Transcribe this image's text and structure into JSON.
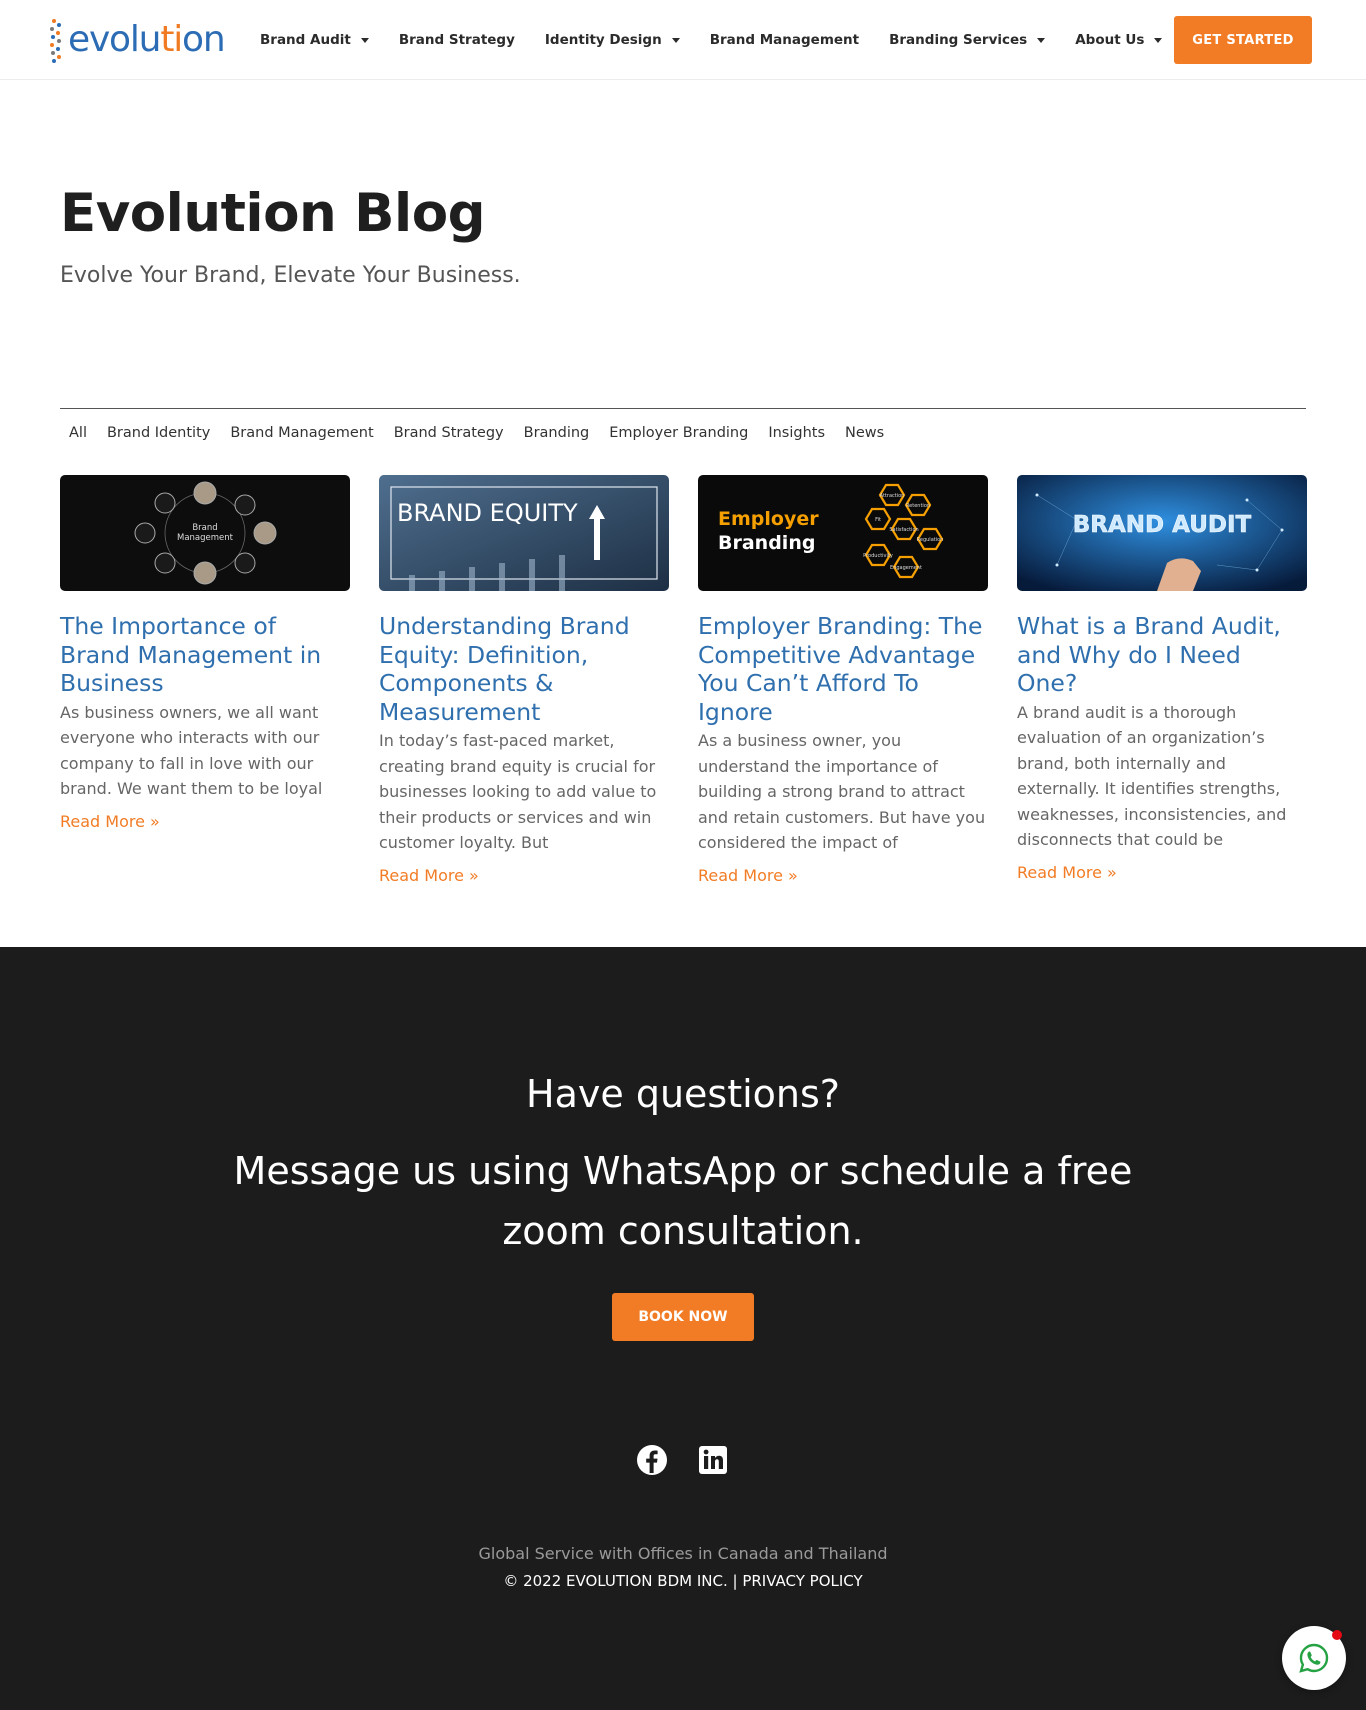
{
  "header": {
    "logo": {
      "part1": "evolu",
      "part2": "ti",
      "part3": "on"
    },
    "nav": [
      {
        "label": "Brand Audit",
        "dropdown": true
      },
      {
        "label": "Brand Strategy",
        "dropdown": false
      },
      {
        "label": "Identity Design",
        "dropdown": true
      },
      {
        "label": "Brand Management",
        "dropdown": false
      },
      {
        "label": "Branding Services",
        "dropdown": true
      },
      {
        "label": "About Us",
        "dropdown": true
      }
    ],
    "cta_label": "GET STARTED"
  },
  "hero": {
    "title": "Evolution Blog",
    "subtitle": "Evolve Your Brand, Elevate Your Business."
  },
  "filters": [
    "All",
    "Brand Identity",
    "Brand Management",
    "Brand Strategy",
    "Branding",
    "Employer Branding",
    "Insights",
    "News"
  ],
  "posts": [
    {
      "title": "The Importance of Brand Management in Business",
      "excerpt": "As business owners, we all want everyone who interacts with our company to fall in love with our brand. We want them to be loyal",
      "read_more": "Read More »",
      "image_text": [
        "Brand",
        "Management"
      ]
    },
    {
      "title": "Understanding Brand Equity: Definition, Components & Measurement",
      "excerpt": "In today’s fast-paced market, creating brand equity is crucial for businesses looking to add value to their products or services and win customer loyalty. But",
      "read_more": "Read More »",
      "image_text": [
        "BRAND EQUITY"
      ]
    },
    {
      "title": "Employer Branding: The Competitive Advantage You Can’t Afford To Ignore",
      "excerpt": "As a business owner, you understand the importance of building a strong brand to attract and retain customers. But have you considered the impact of",
      "read_more": "Read More »",
      "image_text": [
        "Employer",
        "Branding",
        "Attraction",
        "Retention",
        "Fit",
        "Satisfaction",
        "Regulation",
        "Productivity",
        "Engagement"
      ]
    },
    {
      "title": "What is a Brand Audit, and Why do I Need One?",
      "excerpt": "A brand audit is a thorough evaluation of an organization’s brand, both internally and externally. It identifies strengths, weaknesses, inconsistencies, and disconnects that could be",
      "read_more": "Read More »",
      "image_text": [
        "BRAND AUDIT"
      ]
    }
  ],
  "footer": {
    "question": "Have questions?",
    "message": "Message us using WhatsApp or schedule a free zoom consultation.",
    "book_label": "BOOK NOW",
    "social": [
      "facebook-icon",
      "linkedin-icon"
    ],
    "offices": "Global Service with Offices in Canada and Thailand",
    "copyright": "© 2022 EVOLUTION BDM INC.",
    "separator": "|",
    "privacy": "PRIVACY POLICY"
  },
  "colors": {
    "accent": "#f27c25",
    "brand_blue": "#2f6fae",
    "footer_bg": "#1c1c1c"
  }
}
